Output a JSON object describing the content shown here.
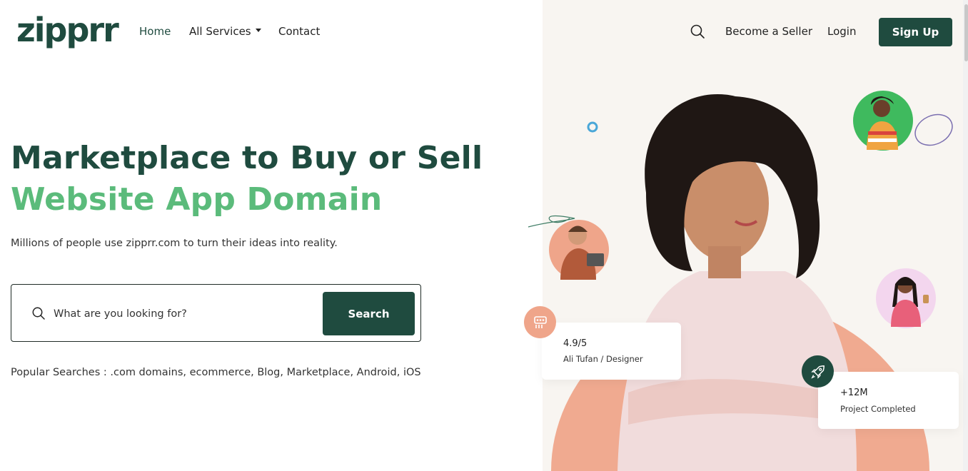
{
  "brand": {
    "logo": "zipprr"
  },
  "nav": {
    "home": "Home",
    "all_services": "All Services",
    "contact": "Contact",
    "become_seller": "Become a Seller",
    "login": "Login",
    "signup": "Sign Up"
  },
  "hero": {
    "line1": "Marketplace to Buy or Sell",
    "line2": "Website App Domain",
    "subtitle": "Millions of people use zipprr.com to turn their ideas into reality."
  },
  "search": {
    "placeholder": "What are you looking for?",
    "button": "Search"
  },
  "popular": {
    "label": "Popular Searches :",
    "items": ".com domains, ecommerce, Blog, Marketplace,  Android, iOS"
  },
  "cards": {
    "rating": {
      "value": "4.9/5",
      "subtitle": "Ali Tufan / Designer"
    },
    "projects": {
      "value": "+12M",
      "subtitle": "Project Completed"
    }
  },
  "colors": {
    "brand_dark": "#1f4b3f",
    "brand_green": "#5bbb7b",
    "accent_peach": "#efa58a",
    "panel_bg": "#f8f5f1"
  },
  "icons": {
    "search": "search-icon",
    "caret": "caret-down-icon",
    "users_badge": "users-icon",
    "rocket_badge": "rocket-icon"
  }
}
